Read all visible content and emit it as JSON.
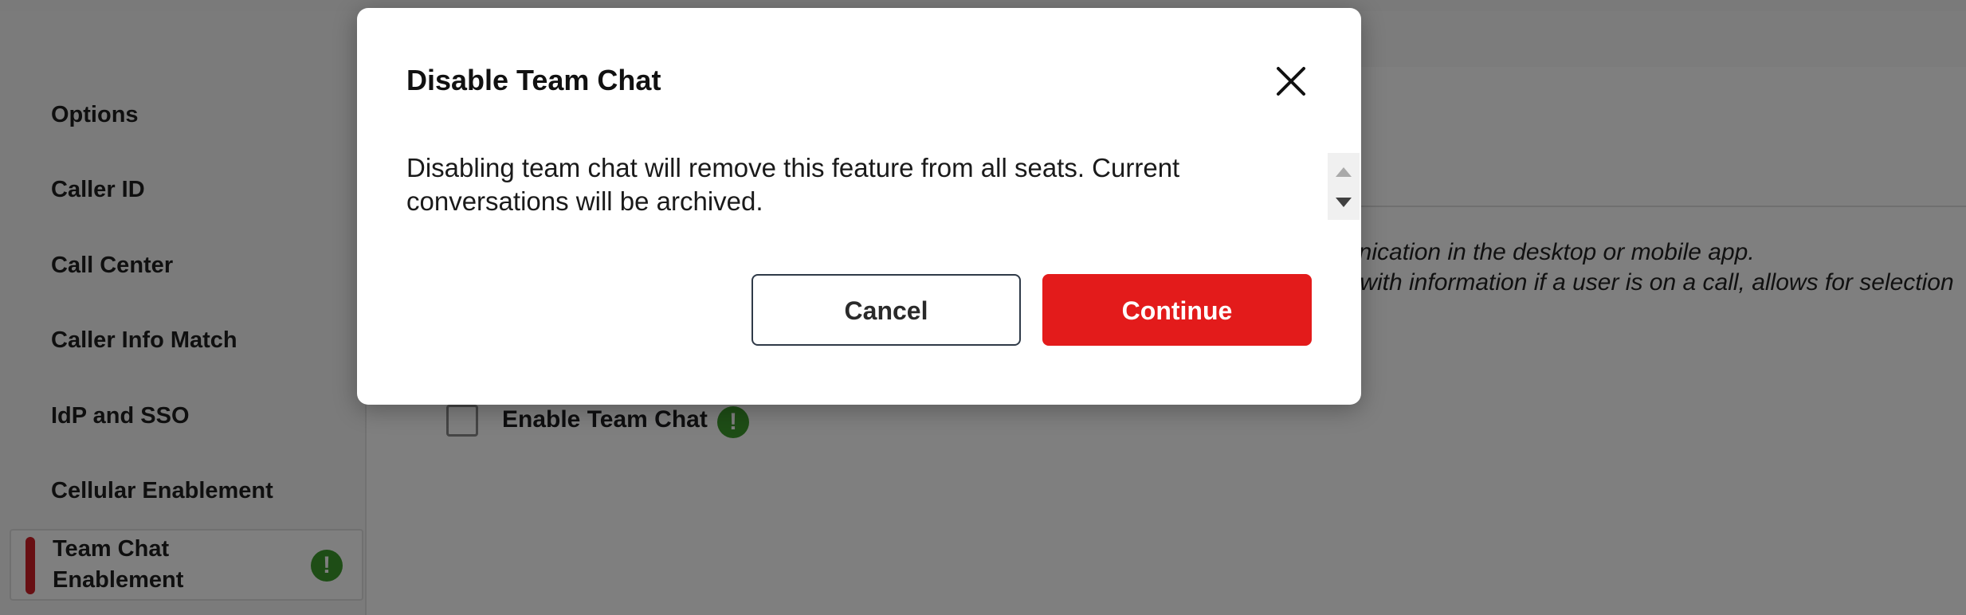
{
  "sidebar": {
    "items": [
      {
        "label": "Options"
      },
      {
        "label": "Caller ID"
      },
      {
        "label": "Call Center"
      },
      {
        "label": "Caller Info Match"
      },
      {
        "label": "IdP and SSO"
      },
      {
        "label": "Cellular Enablement"
      },
      {
        "label": "Team Chat Enablement",
        "active": true
      }
    ],
    "warning_icon": "!"
  },
  "content": {
    "desc_line1": "unication in the desktop or mobile app.",
    "desc_line2": "r with information if a user is on a call, allows for selection",
    "enable_label": "Enable Team Chat",
    "warning_icon": "!"
  },
  "modal": {
    "title": "Disable Team Chat",
    "body": "Disabling team chat will remove this feature from all seats. Current conversations will be archived.",
    "cancel_label": "Cancel",
    "continue_label": "Continue"
  },
  "colors": {
    "accent": "#e31b1b",
    "active_bar": "#d01f26",
    "warning": "#3c9a2c",
    "overlay": "rgba(0,0,0,0.5)"
  }
}
